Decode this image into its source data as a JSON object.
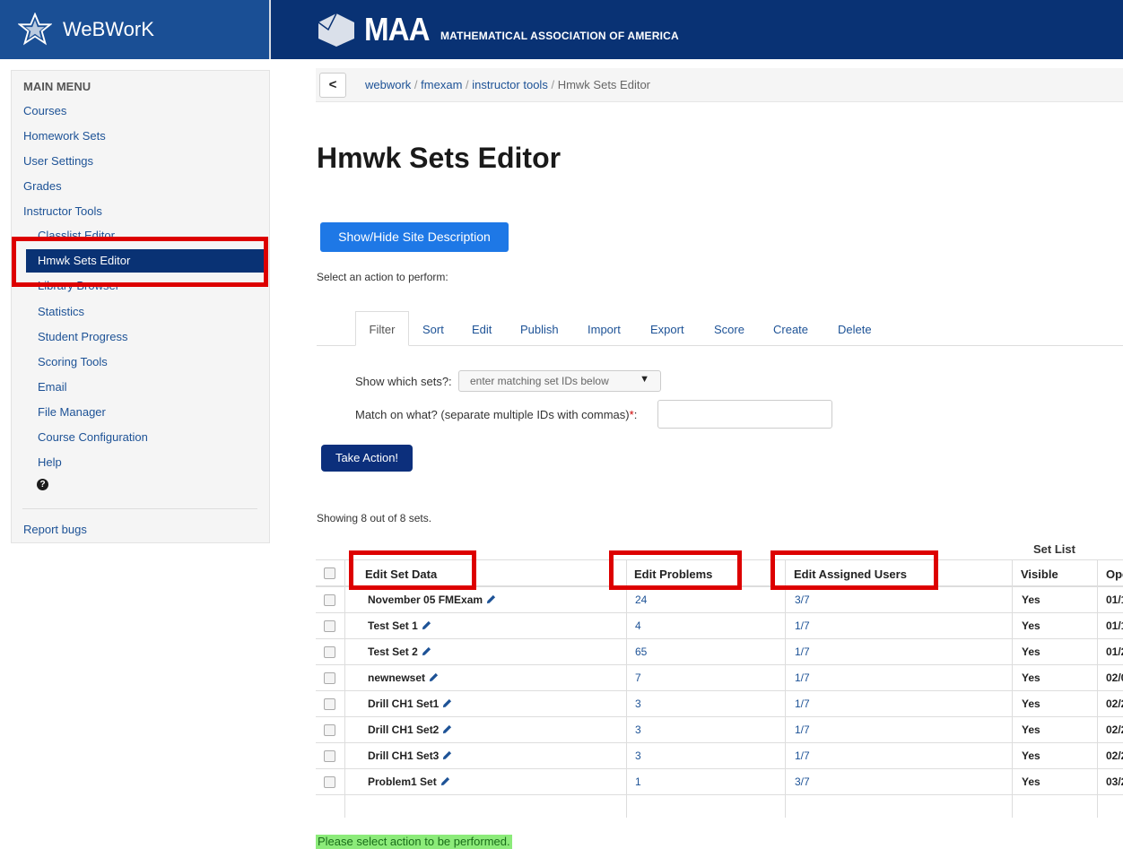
{
  "brand": {
    "title": "WeBWorK"
  },
  "maa": {
    "big": "MAA",
    "small": "MATHEMATICAL ASSOCIATION OF AMERICA"
  },
  "sidebar": {
    "heading": "MAIN MENU",
    "items": [
      "Courses",
      "Homework Sets",
      "User Settings",
      "Grades",
      "Instructor Tools"
    ],
    "sub_items": [
      "Classlist Editor",
      "Hmwk Sets Editor",
      "Library Browser",
      "Statistics",
      "Student Progress",
      "Scoring Tools",
      "Email",
      "File Manager",
      "Course Configuration",
      "Help"
    ],
    "report": "Report bugs"
  },
  "breadcrumb": {
    "back": "<",
    "parts": [
      "webwork",
      "fmexam",
      "instructor tools",
      "Hmwk Sets Editor"
    ],
    "sep": "/"
  },
  "page": {
    "title": "Hmwk Sets Editor",
    "show_hide_label": "Show/Hide Site Description",
    "prompt": "Select an action to perform:",
    "showing": "Showing 8 out of 8 sets.",
    "status": "Please select action to be performed."
  },
  "tabs": [
    "Filter",
    "Sort",
    "Edit",
    "Publish",
    "Import",
    "Export",
    "Score",
    "Create",
    "Delete"
  ],
  "filter": {
    "which_label": "Show which sets?:",
    "which_value": "enter matching set IDs below",
    "which_arrow": "▼",
    "match_label": "Match on what? (separate multiple IDs with commas)",
    "required": "*",
    "colon": ":",
    "action_label": "Take Action!"
  },
  "table": {
    "caption": "Set List",
    "headers": [
      "Edit Set Data",
      "Edit Problems",
      "Edit Assigned Users",
      "Visible",
      "Ope"
    ],
    "rows": [
      {
        "name": "November 05 FMExam",
        "problems": "24",
        "users": "3/7",
        "visible": "Yes",
        "open": "01/1"
      },
      {
        "name": "Test Set 1",
        "problems": "4",
        "users": "1/7",
        "visible": "Yes",
        "open": "01/1"
      },
      {
        "name": "Test Set 2",
        "problems": "65",
        "users": "1/7",
        "visible": "Yes",
        "open": "01/2"
      },
      {
        "name": "newnewset",
        "problems": "7",
        "users": "1/7",
        "visible": "Yes",
        "open": "02/0"
      },
      {
        "name": "Drill CH1 Set1",
        "problems": "3",
        "users": "1/7",
        "visible": "Yes",
        "open": "02/2"
      },
      {
        "name": "Drill CH1 Set2",
        "problems": "3",
        "users": "1/7",
        "visible": "Yes",
        "open": "02/2"
      },
      {
        "name": "Drill CH1 Set3",
        "problems": "3",
        "users": "1/7",
        "visible": "Yes",
        "open": "02/2"
      },
      {
        "name": "Problem1 Set",
        "problems": "1",
        "users": "3/7",
        "visible": "Yes",
        "open": "03/2"
      }
    ]
  },
  "colors": {
    "nav": "#093274",
    "brand_box": "#1a4f95",
    "link": "#1d5296",
    "primary": "#1e78e6",
    "highlight": "#dd0000",
    "success": "#8ceb7a"
  }
}
